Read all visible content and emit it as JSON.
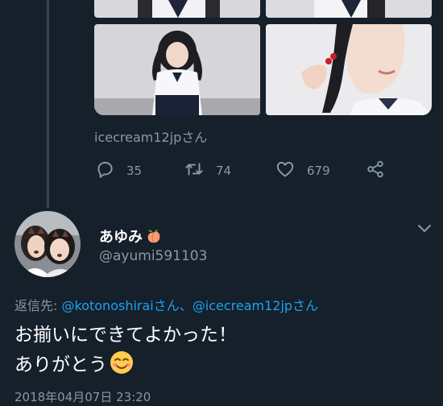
{
  "quoted": {
    "via_text": "icecream12jpさん"
  },
  "actions": {
    "reply_count": "35",
    "retweet_count": "74",
    "like_count": "679"
  },
  "tweet": {
    "display_name": "あゆみ",
    "handle": "@ayumi591103",
    "reply_label": "返信先:",
    "mention_1": "@kotonoshiraiさん",
    "separator": "、",
    "mention_2": "@icecream12jpさん",
    "text_line1": "お揃いにできてよかった！",
    "text_line2": "ありがとう",
    "timestamp": "2018年04月07日 23:20"
  },
  "icons": {
    "name_emoji": "peach-emoji",
    "text_emoji": "smiling-face-emoji",
    "reply": "reply-icon",
    "retweet": "retweet-icon",
    "like": "heart-icon",
    "share": "share-icon",
    "more": "chevron-down-icon"
  },
  "colors": {
    "background": "#15202b",
    "secondary_text": "#8899a6",
    "link": "#1da1f2"
  }
}
